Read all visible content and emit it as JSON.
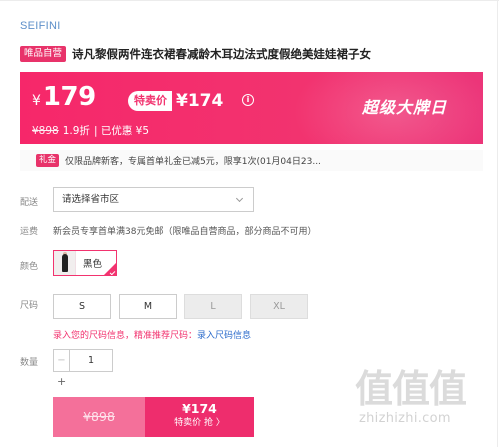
{
  "brand": "SEIFINI",
  "product": {
    "tag": "唯品自营",
    "title": "诗凡黎假两件连衣裙春减龄木耳边法式度假绝美娃娃裙子女"
  },
  "price": {
    "currency": "¥",
    "current": "179",
    "special_label": "特卖价",
    "special_price": "¥174",
    "info_icon": "info-circle-icon",
    "original": "¥898",
    "discount": "1.9折",
    "saved": "| 已优惠 ¥5",
    "event": "超级大牌日"
  },
  "gift": {
    "tag": "礼金",
    "text": "仅限品牌新客，专属首单礼金已减5元，限享1次(01月04日23..."
  },
  "shipping": {
    "label": "配送",
    "select_value": "请选择省市区"
  },
  "fee": {
    "label": "运费",
    "text": "新会员专享首单满38元免邮（限唯品自营商品，部分商品不可用）"
  },
  "color": {
    "label": "颜色",
    "option": "黑色"
  },
  "size": {
    "label": "尺码",
    "options": [
      "S",
      "M",
      "L",
      "XL"
    ],
    "disabled": [
      false,
      false,
      true,
      true
    ],
    "info_prefix": "录入您的尺码信息，精准推荐尺码：",
    "info_link": "录入尺码信息"
  },
  "quantity": {
    "label": "数量",
    "minus": "−",
    "value": "1",
    "plus": "+"
  },
  "buy": {
    "original": "¥898",
    "price": "¥174",
    "action": "特卖价 抢 〉"
  },
  "watermark": {
    "glyphs": "值值值",
    "url": "zhizhizhi.com"
  },
  "colors": {
    "accent": "#f2336f",
    "brand": "#5d8fc9",
    "link": "#2e6dcc"
  }
}
